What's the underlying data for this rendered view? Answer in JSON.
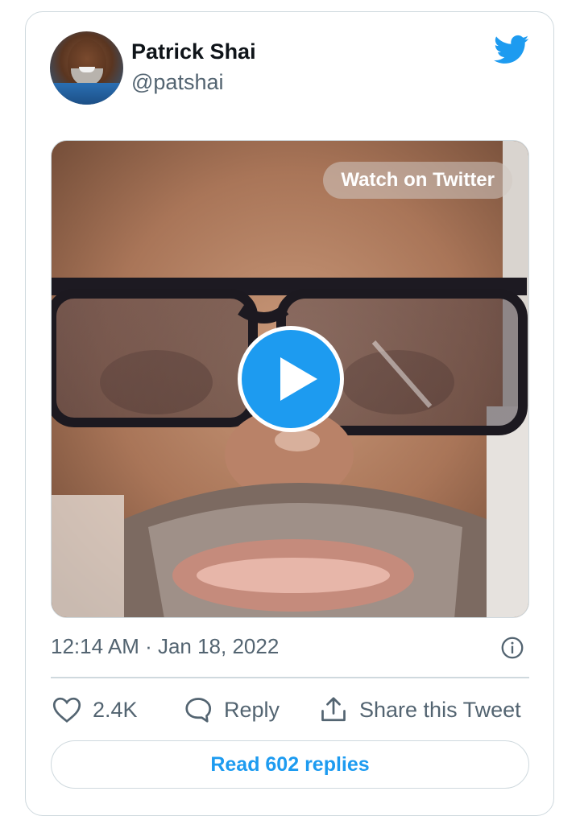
{
  "author": {
    "name": "Patrick Shai",
    "handle": "@patshai"
  },
  "media": {
    "watch_label": "Watch on Twitter"
  },
  "tweet": {
    "timestamp": "12:14 AM · Jan 18, 2022"
  },
  "actions": {
    "like_count": "2.4K",
    "reply_label": "Reply",
    "share_label": "Share this Tweet"
  },
  "read_replies_label": "Read 602 replies",
  "icons": {
    "brand": "twitter-bird-icon",
    "info": "info-icon",
    "like": "heart-icon",
    "reply": "speech-bubble-icon",
    "share": "share-upload-icon"
  },
  "colors": {
    "accent": "#1d9bf0",
    "secondary_text": "#536471",
    "border": "#cfd9de"
  }
}
